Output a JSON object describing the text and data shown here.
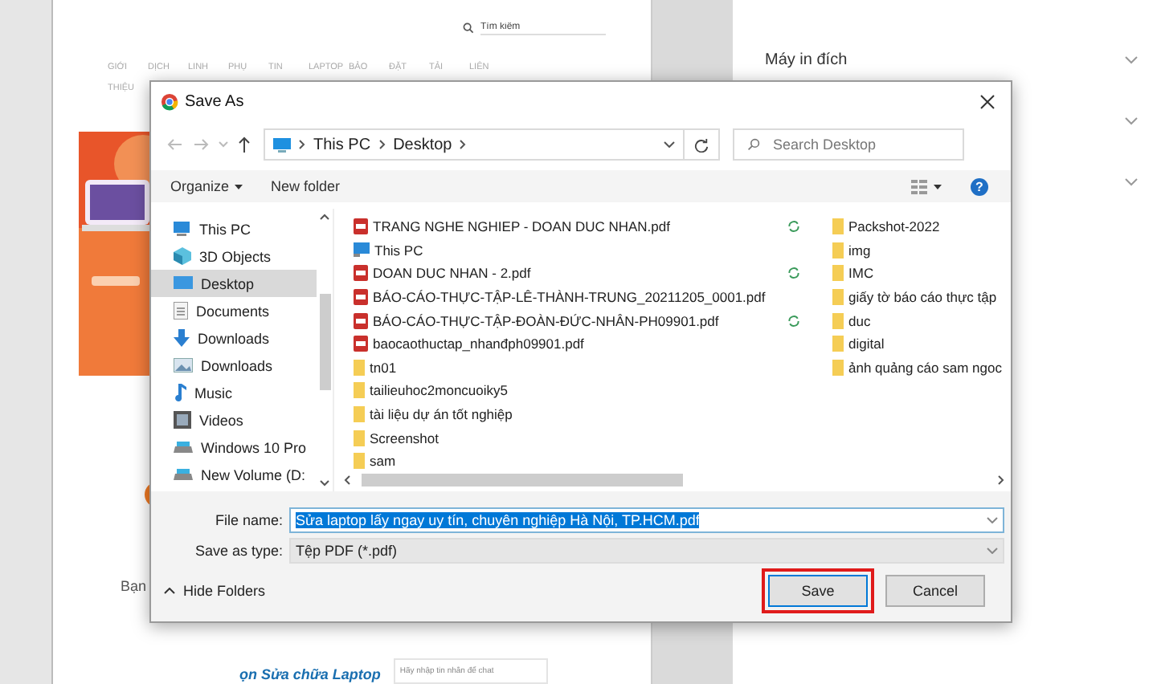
{
  "print_preview": {
    "search": {
      "placeholder": "Tìm kiếm"
    },
    "nav_items": [
      "GIỚI THIỆU",
      "DỊCH",
      "LINH",
      "PHỤ",
      "TIN",
      "LAPTOP",
      "BẢO",
      "ĐẶT",
      "TẢI",
      "LIÊN"
    ],
    "section_heading": "Bạn",
    "link_text": "ọn Sửa chữa Laptop",
    "chat": {
      "placeholder": "Hãy nhập tin nhắn để chat"
    },
    "settings": [
      {
        "kind": "labeled",
        "label": "Máy in đích"
      },
      {
        "kind": "dropdown"
      },
      {
        "kind": "dropdown"
      }
    ]
  },
  "dialog": {
    "title": "Save As",
    "path": [
      "This PC",
      "Desktop"
    ],
    "search": {
      "placeholder": "Search Desktop"
    },
    "toolbar": {
      "organize": "Organize",
      "new_folder": "New folder",
      "help": "?"
    },
    "tree": [
      {
        "label": "This PC",
        "kind": "pc",
        "selected": false
      },
      {
        "label": "3D Objects",
        "kind": "objects",
        "selected": false
      },
      {
        "label": "Desktop",
        "kind": "desktop",
        "selected": true
      },
      {
        "label": "Documents",
        "kind": "documents",
        "selected": false
      },
      {
        "label": "Downloads",
        "kind": "downloads",
        "selected": false
      },
      {
        "label": "Downloads",
        "kind": "pictures",
        "selected": false
      },
      {
        "label": "Music",
        "kind": "music",
        "selected": false
      },
      {
        "label": "Videos",
        "kind": "videos",
        "selected": false
      },
      {
        "label": "Windows 10 Pro",
        "kind": "drive",
        "selected": false
      },
      {
        "label": "New Volume (D:",
        "kind": "drive",
        "selected": false
      }
    ],
    "files": [
      {
        "name": "TRANG NGHE NGHIEP - DOAN DUC NHAN.pdf",
        "kind": "pdf",
        "synced": true
      },
      {
        "name": "This PC",
        "kind": "pc",
        "synced": false
      },
      {
        "name": "DOAN DUC NHAN - 2.pdf",
        "kind": "pdf",
        "synced": true
      },
      {
        "name": "BÁO-CÁO-THỰC-TẬP-LÊ-THÀNH-TRUNG_20211205_0001.pdf",
        "kind": "pdf",
        "synced": false
      },
      {
        "name": "BÁO-CÁO-THỰC-TẬP-ĐOÀN-ĐỨC-NHÂN-PH09901.pdf",
        "kind": "pdf",
        "synced": true
      },
      {
        "name": "baocaothuctap_nhanđph09901.pdf",
        "kind": "pdf",
        "synced": false
      },
      {
        "name": "tn01",
        "kind": "folder",
        "synced": false
      },
      {
        "name": "tailieuhoc2moncuoiky5",
        "kind": "folder",
        "synced": false
      },
      {
        "name": "tài liệu dự án tốt nghiệp",
        "kind": "folder",
        "synced": false
      },
      {
        "name": "Screenshot",
        "kind": "folder",
        "synced": false
      },
      {
        "name": "sam",
        "kind": "folder",
        "synced": false
      },
      {
        "name": "Packshot-2022",
        "kind": "folder",
        "synced": false
      },
      {
        "name": "img",
        "kind": "folder",
        "synced": false
      },
      {
        "name": "IMC",
        "kind": "folder",
        "synced": false
      },
      {
        "name": "giấy tờ báo cáo thực tập",
        "kind": "folder",
        "synced": false
      },
      {
        "name": "duc",
        "kind": "folder",
        "synced": false
      },
      {
        "name": "digital",
        "kind": "folder",
        "synced": false
      },
      {
        "name": "ảnh quảng cáo sam ngoc",
        "kind": "folder",
        "synced": false
      }
    ],
    "file_name": {
      "label": "File name:",
      "value": "Sửa laptop lấy ngay uy tín, chuyên nghiệp Hà Nội, TP.HCM.pdf",
      "selected": true
    },
    "save_type": {
      "label": "Save as type:",
      "value": "Tệp PDF (*.pdf)"
    },
    "hide_folders": "Hide Folders",
    "buttons": [
      {
        "label": "Save",
        "highlighted": true
      },
      {
        "label": "Cancel",
        "highlighted": false
      }
    ]
  }
}
